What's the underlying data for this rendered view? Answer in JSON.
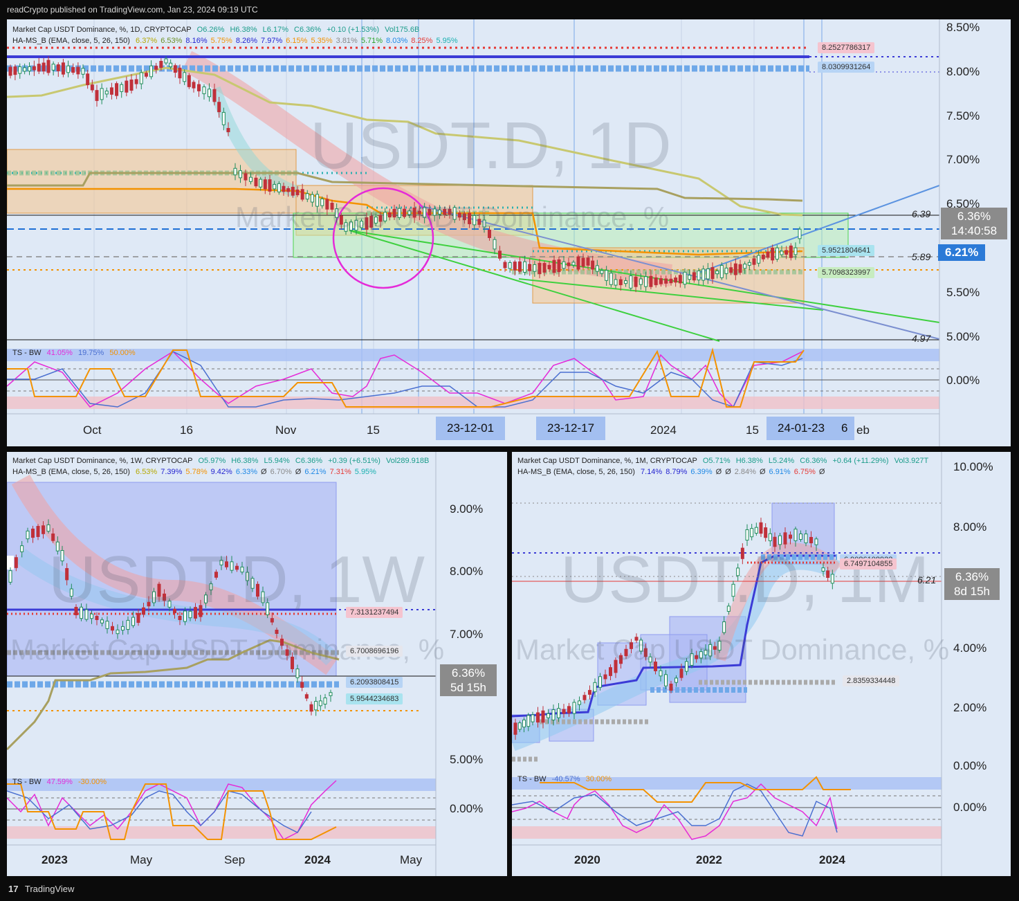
{
  "header": {
    "publisher_line": "readCrypto published on TradingView.com, Jan 23, 2024 09:19 UTC"
  },
  "footer": {
    "brand": "TradingView",
    "logo_glyph": "17"
  },
  "main": {
    "watermark_big": "USDT.D, 1D",
    "watermark_small": "Market Cap USDT Dominance, %",
    "legend_line1": {
      "name": "Market Cap USDT Dominance, %, 1D, CRYPTOCAP",
      "o": "O6.26%",
      "h": "H6.38%",
      "l": "L6.17%",
      "c": "C6.36%",
      "chg": "+0.10 (+1.53%)",
      "vol": "Vol175.6B"
    },
    "legend_line2": {
      "name": "HA-MS_B (EMA, close, 5, 26, 150)",
      "values": [
        {
          "t": "6.37%",
          "color": "#b5a800"
        },
        {
          "t": "6.53%",
          "color": "#6b8e23"
        },
        {
          "t": "8.16%",
          "color": "#2323d0"
        },
        {
          "t": "5.75%",
          "color": "#f39200"
        },
        {
          "t": "8.26%",
          "color": "#2323d0"
        },
        {
          "t": "7.97%",
          "color": "#2323d0"
        },
        {
          "t": "6.15%",
          "color": "#f39200"
        },
        {
          "t": "5.35%",
          "color": "#f39200"
        },
        {
          "t": "3.81%",
          "color": "#888888"
        },
        {
          "t": "5.71%",
          "color": "#28a428"
        },
        {
          "t": "8.03%",
          "color": "#1e88e5"
        },
        {
          "t": "8.25%",
          "color": "#e53935"
        },
        {
          "t": "5.95%",
          "color": "#1ab0b0"
        }
      ]
    },
    "y_ticks": [
      "8.50%",
      "8.00%",
      "7.50%",
      "7.00%",
      "6.50%",
      "5.50%",
      "5.00%"
    ],
    "ts_zero": "0.00%",
    "x_ticks": [
      "Oct",
      "16",
      "Nov",
      "15",
      "2024",
      "15",
      "eb"
    ],
    "date_badges": [
      "23-12-01",
      "23-12-17",
      "24-01-23",
      "6"
    ],
    "levels": [
      "8.2527786317",
      "8.0309931264",
      "5.9521804641",
      "5.7098323997"
    ],
    "marks": [
      "6.39",
      "5.89",
      "4.97"
    ],
    "price_tag": {
      "price": "6.36%",
      "countdown": "14:40:58"
    },
    "blue_tag": "6.21%",
    "ts_legend": {
      "name": "TS - BW",
      "v1": "41.05%",
      "v2": "19.75%",
      "v3": "50.00%"
    }
  },
  "weekly": {
    "watermark_big": "USDT.D, 1W",
    "watermark_small": "Market Cap USDT Dominance, %",
    "legend_line1": {
      "name": "Market Cap USDT Dominance, %, 1W, CRYPTOCAP",
      "o": "O5.97%",
      "h": "H6.38%",
      "l": "L5.94%",
      "c": "C6.36%",
      "chg": "+0.39 (+6.51%)",
      "vol": "Vol289.918B"
    },
    "legend_line2": {
      "name": "HA-MS_B (EMA, close, 5, 26, 150)",
      "values": [
        {
          "t": "6.53%",
          "color": "#b5a800"
        },
        {
          "t": "7.39%",
          "color": "#2323d0"
        },
        {
          "t": "5.78%",
          "color": "#f39200"
        },
        {
          "t": "9.42%",
          "color": "#2323d0"
        },
        {
          "t": "6.33%",
          "color": "#1e88e5"
        },
        {
          "t": "Ø",
          "color": "#333333"
        },
        {
          "t": "6.70%",
          "color": "#888888"
        },
        {
          "t": "Ø",
          "color": "#333333"
        },
        {
          "t": "6.21%",
          "color": "#1e88e5"
        },
        {
          "t": "7.31%",
          "color": "#e53935"
        },
        {
          "t": "5.95%",
          "color": "#1ab0b0"
        }
      ]
    },
    "y_ticks": [
      "9.00%",
      "8.00%",
      "7.00%",
      "5.00%"
    ],
    "ts_zero": "0.00%",
    "x_ticks": [
      "2023",
      "May",
      "Sep",
      "2024",
      "May"
    ],
    "levels": [
      "7.3131237494",
      "6.7008696196",
      "6.2093808415",
      "5.9544234683"
    ],
    "price_tag": {
      "price": "6.36%",
      "countdown": "5d 15h"
    },
    "ts_legend": {
      "name": "TS - BW",
      "v1": "47.59%",
      "v2": "-30.00%"
    }
  },
  "monthly": {
    "watermark_big": "USDT.D, 1M",
    "watermark_small": "Market Cap USDT Dominance, %",
    "legend_line1": {
      "name": "Market Cap USDT Dominance, %, 1M, CRYPTOCAP",
      "o": "O5.71%",
      "h": "H6.38%",
      "l": "L5.24%",
      "c": "C6.36%",
      "chg": "+0.64 (+11.29%)",
      "vol": "Vol3.927T"
    },
    "legend_line2": {
      "name": "HA-MS_B (EMA, close, 5, 26, 150)",
      "values": [
        {
          "t": "7.14%",
          "color": "#2323d0"
        },
        {
          "t": "8.79%",
          "color": "#2323d0"
        },
        {
          "t": "6.39%",
          "color": "#1e88e5"
        },
        {
          "t": "Ø",
          "color": "#333333"
        },
        {
          "t": "Ø",
          "color": "#333333"
        },
        {
          "t": "2.84%",
          "color": "#888888"
        },
        {
          "t": "Ø",
          "color": "#333333"
        },
        {
          "t": "6.91%",
          "color": "#1e88e5"
        },
        {
          "t": "6.75%",
          "color": "#e53935"
        },
        {
          "t": "Ø",
          "color": "#333333"
        }
      ]
    },
    "y_ticks": [
      "10.00%",
      "8.00%",
      "4.00%",
      "2.00%",
      "0.00%"
    ],
    "ts_zero": "0.00%",
    "x_ticks": [
      "2020",
      "2022",
      "2024"
    ],
    "levels": [
      "6.9086108922",
      "6.7497104855",
      "2.8359334448"
    ],
    "marks": [
      "6.21"
    ],
    "price_tag": {
      "price": "6.36%",
      "countdown": "8d 15h"
    },
    "ts_legend": {
      "name": "TS - BW",
      "v1": "-40.57%",
      "v2": "30.00%"
    }
  }
}
